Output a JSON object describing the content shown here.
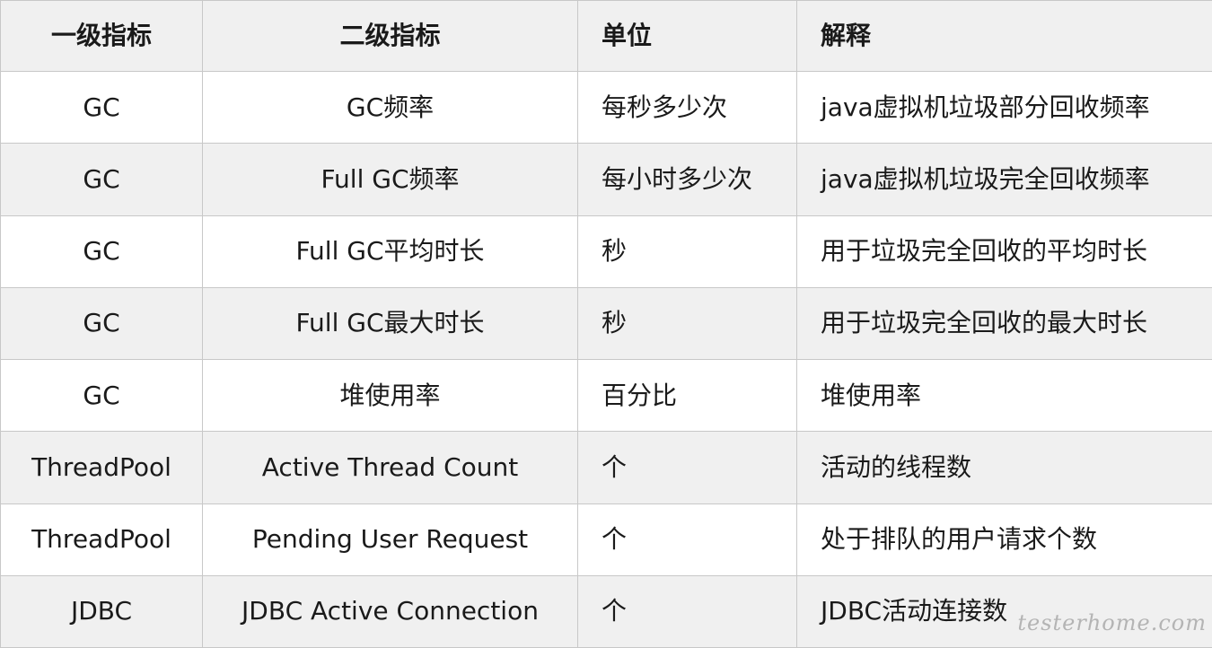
{
  "table": {
    "headers": [
      "一级指标",
      "二级指标",
      "单位",
      "解释"
    ],
    "rows": [
      [
        "GC",
        "GC频率",
        "每秒多少次",
        "java虚拟机垃圾部分回收频率"
      ],
      [
        "GC",
        "Full GC频率",
        "每小时多少次",
        "java虚拟机垃圾完全回收频率"
      ],
      [
        "GC",
        "Full GC平均时长",
        "秒",
        "用于垃圾完全回收的平均时长"
      ],
      [
        "GC",
        "Full GC最大时长",
        "秒",
        "用于垃圾完全回收的最大时长"
      ],
      [
        "GC",
        "堆使用率",
        "百分比",
        "堆使用率"
      ],
      [
        "ThreadPool",
        "Active Thread Count",
        "个",
        "活动的线程数"
      ],
      [
        "ThreadPool",
        "Pending User Request",
        "个",
        "处于排队的用户请求个数"
      ],
      [
        "JDBC",
        "JDBC Active Connection",
        "个",
        "JDBC活动连接数"
      ]
    ]
  },
  "watermark": "testerhome.com",
  "colors": {
    "header_bg": "#f0f0f0",
    "stripe_bg": "#f0f0f0",
    "row_bg": "#ffffff",
    "border": "#c8c8c8",
    "text": "#1a1a1a"
  }
}
